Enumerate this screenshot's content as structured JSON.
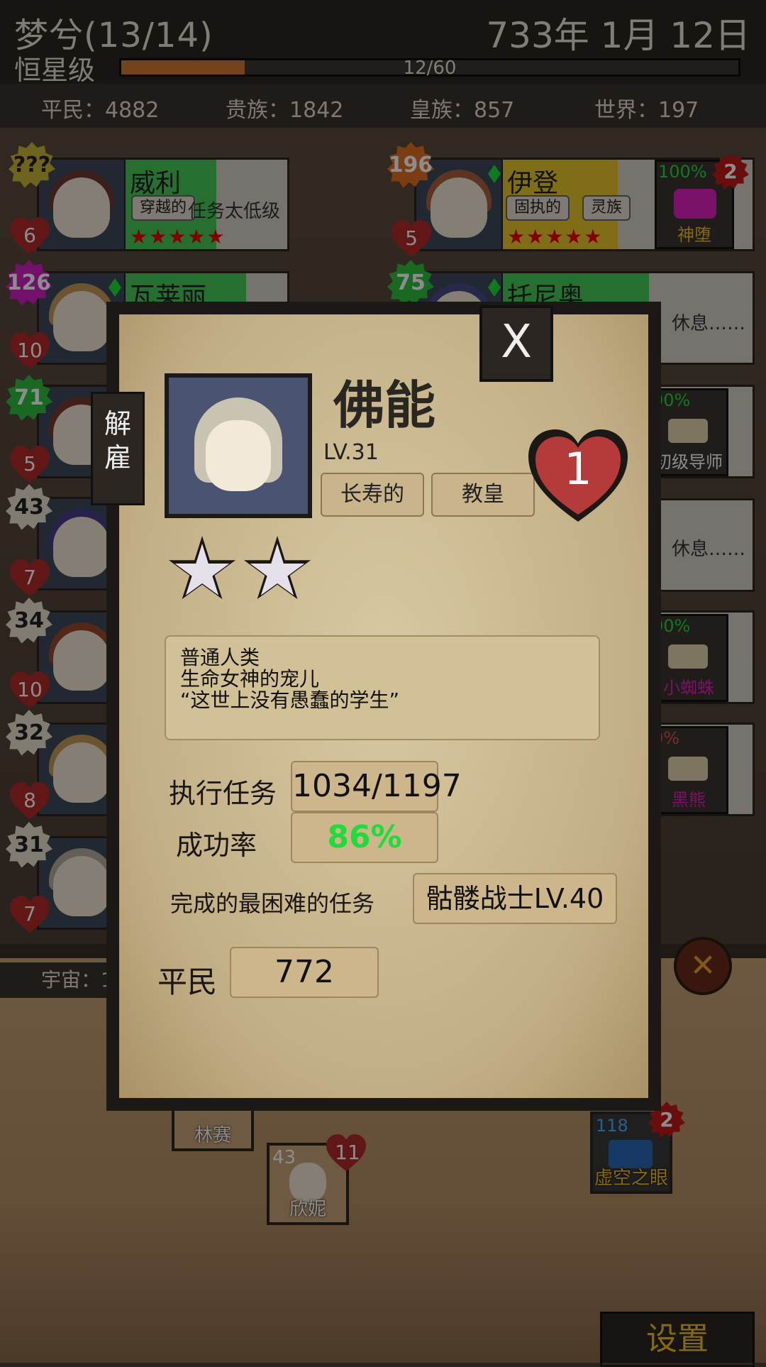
{
  "header": {
    "guild_name": "梦兮(13/14)",
    "date": "733年 1月 12日",
    "rank": "恒星级",
    "xp_text": "12/60",
    "xp_progress": 0.2
  },
  "population": {
    "commoner": "平民：4882",
    "noble": "贵族：1842",
    "royal": "皇族：857",
    "world": "世界：197"
  },
  "heroes_left": [
    {
      "name": "威利",
      "badge": "???",
      "heart": "6",
      "tag": "穿越的",
      "status": "任务太低级",
      "stars": "★★★★★"
    },
    {
      "name": "瓦莱丽",
      "badge": "126",
      "heart": "10"
    },
    {
      "badge": "71",
      "heart": "5"
    },
    {
      "badge": "43",
      "heart": "7"
    },
    {
      "badge": "34",
      "heart": "10"
    },
    {
      "badge": "32",
      "heart": "8"
    },
    {
      "badge": "31",
      "heart": "7"
    }
  ],
  "heroes_right": [
    {
      "name": "伊登",
      "badge": "196",
      "heart": "5",
      "tag1": "固执的",
      "tag2": "灵族",
      "stars": "★★★★★",
      "task_pct": "100%",
      "task_name": "神堕",
      "task_count": "2"
    },
    {
      "name": "托尼奥",
      "badge": "75",
      "status": "休息……"
    }
  ],
  "side_tasks": [
    {
      "pct": "00%",
      "name": "初级导师"
    },
    {
      "status": "休息……"
    },
    {
      "pct": "00%",
      "name": "小蜘蛛"
    },
    {
      "pct": "0%",
      "name": "黑熊"
    }
  ],
  "dialog": {
    "close_label": "X",
    "fire_label": "解雇",
    "hero_name": "佛能",
    "level": "LV.31",
    "trait1": "长寿的",
    "trait2": "教皇",
    "heart_value": "1",
    "star_count": 2,
    "desc": [
      "普通人类",
      "生命女神的宠儿",
      "“这世上没有愚蠢的学生”"
    ],
    "tasks_label": "执行任务",
    "tasks_value": "1034/1197",
    "success_label": "成功率",
    "success_value": "86%",
    "hardest_label": "完成的最困难的任务",
    "hardest_value": "骷髅战士LV.40",
    "class_label": "平民",
    "class_value": "772"
  },
  "bottom": {
    "universe": "宇宙：1",
    "hero1_name": "林赛",
    "hero2_badge": "43",
    "hero2_heart": "11",
    "hero2_name": "欣妮",
    "task_count": "118",
    "task_badge": "2",
    "task_name": "虚空之眼",
    "settings_label": "设置"
  },
  "colors": {
    "xp_fill": "#d07a35",
    "success_green": "#1fdc3b",
    "heart_red": "#b53a3a",
    "settings_gold": "#f0c020"
  }
}
